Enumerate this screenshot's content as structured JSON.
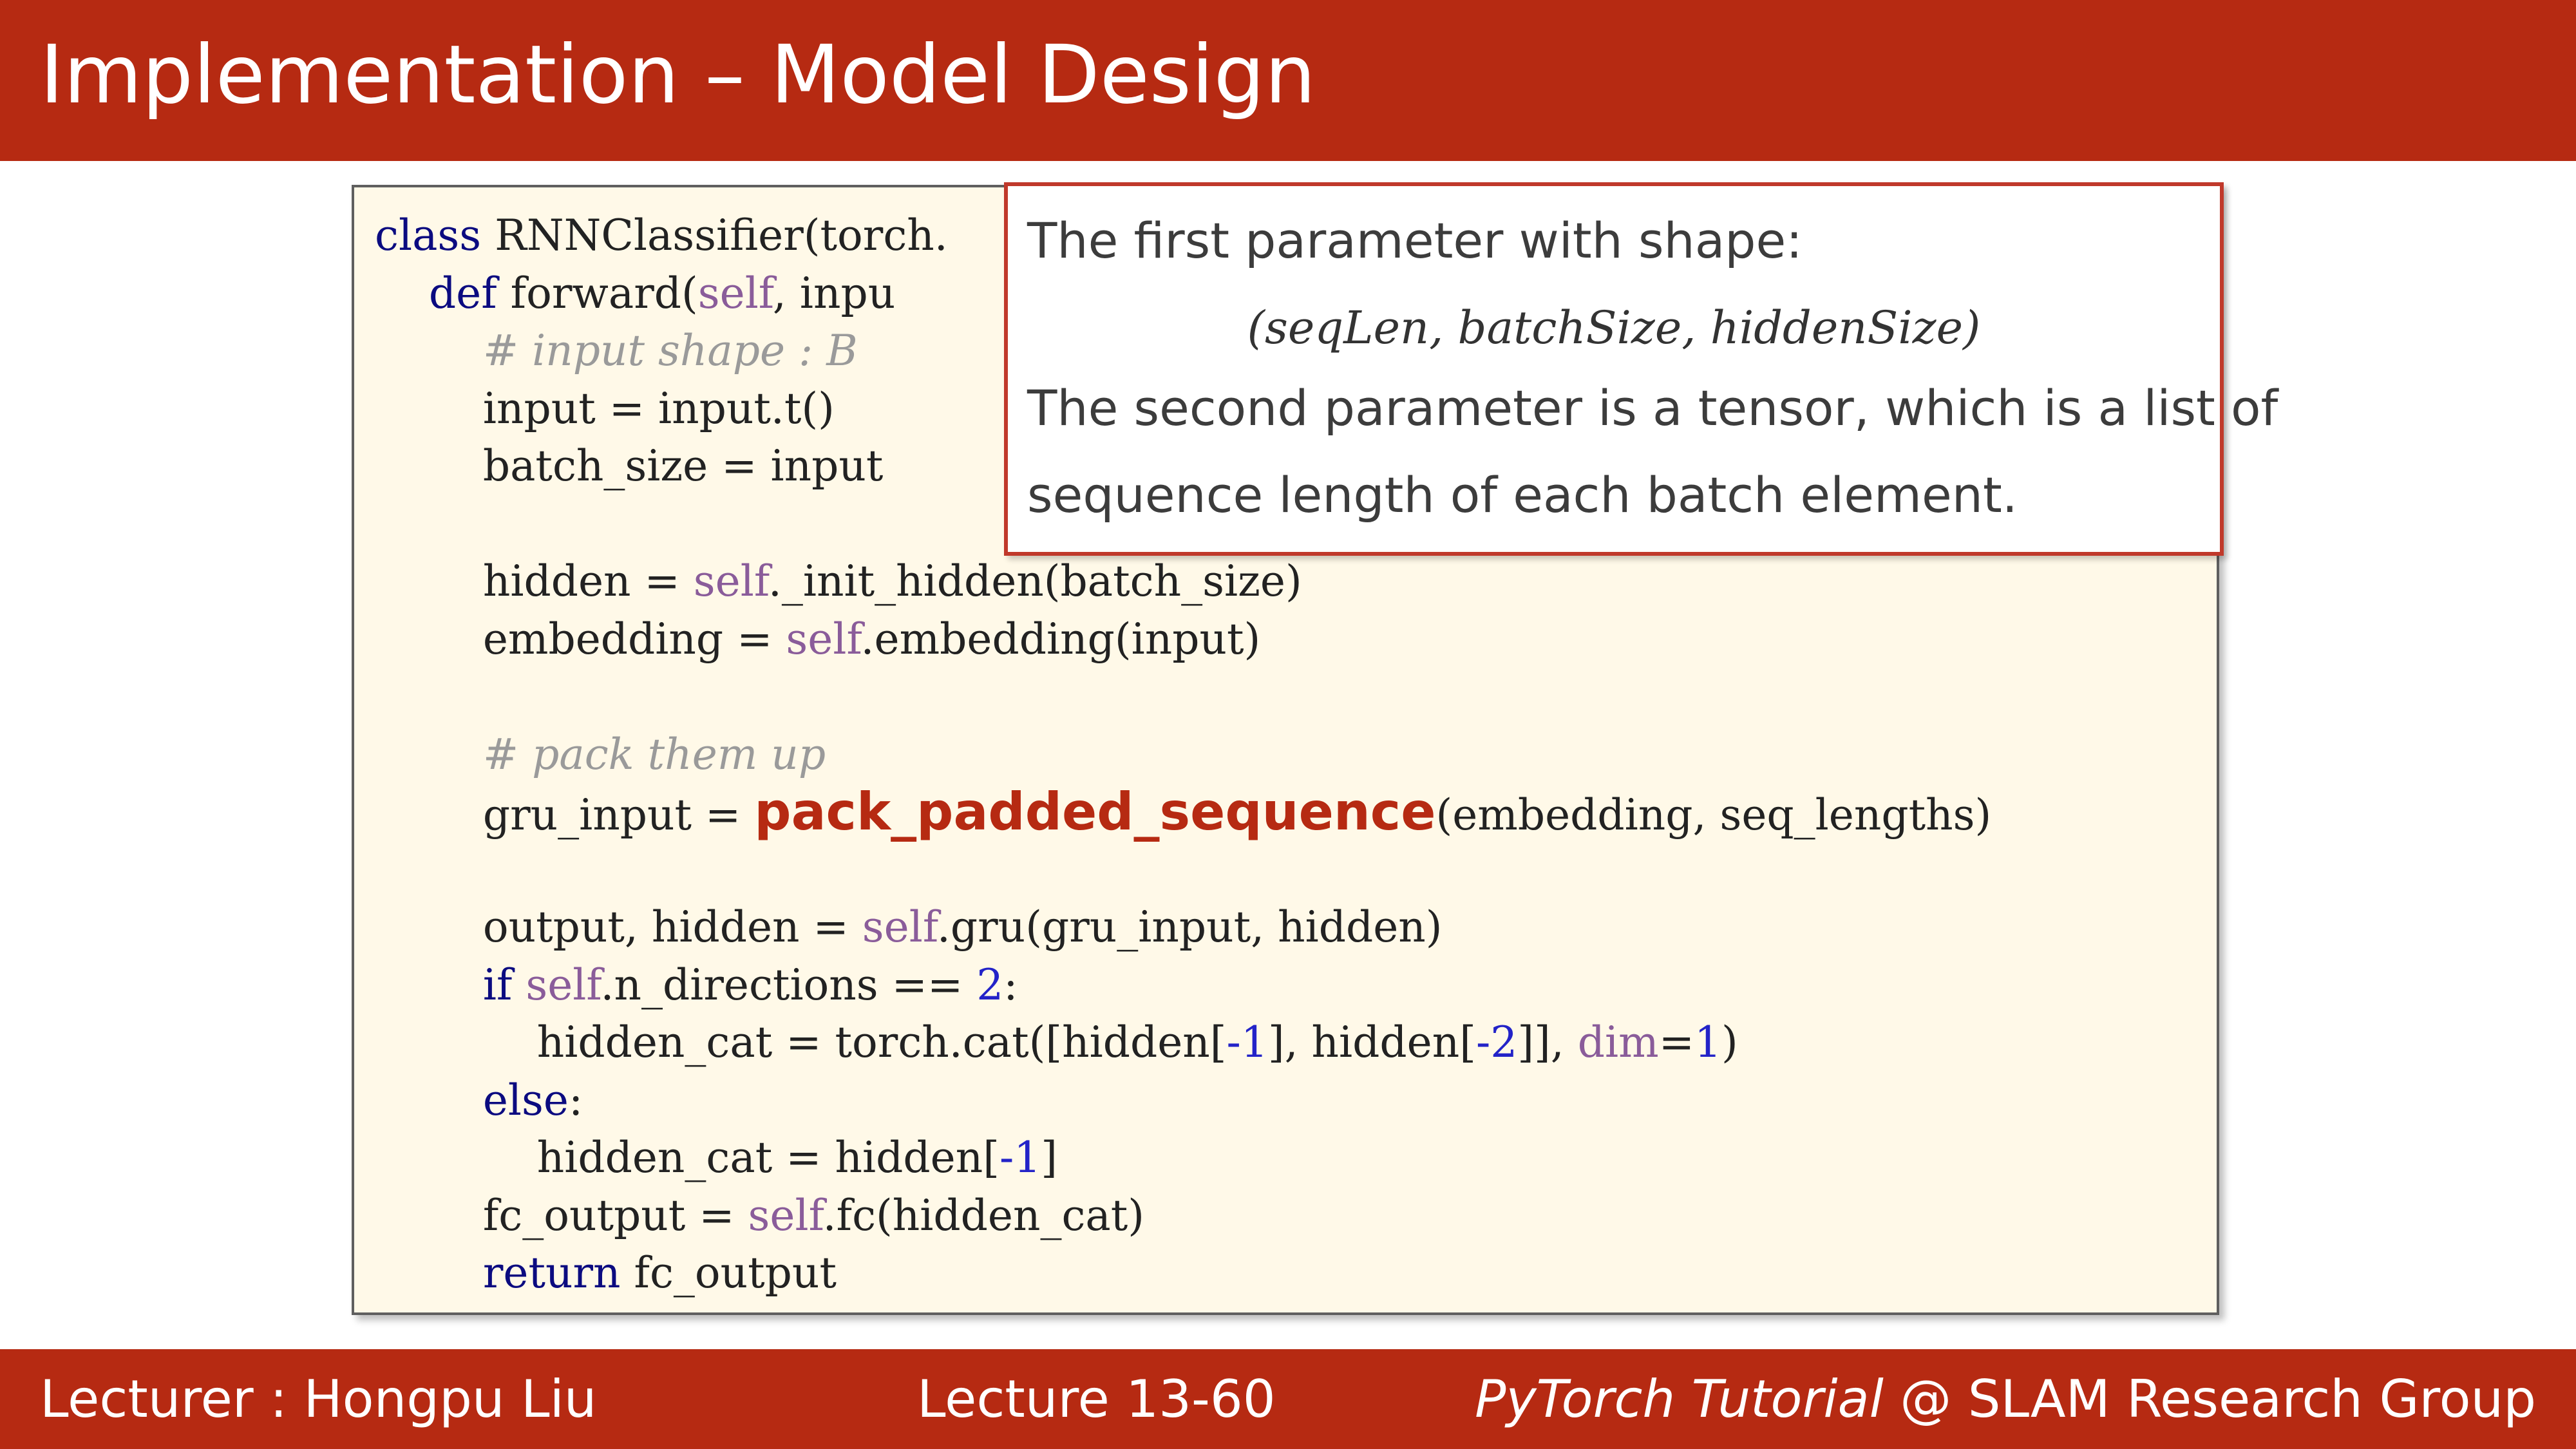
{
  "slide": {
    "title": "Implementation – Model Design"
  },
  "colors": {
    "brand": "#b62a12",
    "code_background": "#fff9e8",
    "callout_border": "#c0392b",
    "keyword": "#0b0b80",
    "self": "#8a5c9a",
    "comment": "#9a9a9a",
    "number": "#2323c8"
  },
  "code": {
    "lines": [
      [
        {
          "t": "class",
          "c": "kw"
        },
        {
          "t": " RNNClassifier(torch."
        }
      ],
      [
        {
          "t": "    "
        },
        {
          "t": "def",
          "c": "kw"
        },
        {
          "t": " forward("
        },
        {
          "t": "self",
          "c": "slf"
        },
        {
          "t": ", inpu"
        }
      ],
      [
        {
          "t": "        "
        },
        {
          "t": "# input shape : B",
          "c": "cm"
        }
      ],
      [
        {
          "t": "        input = input.t()"
        }
      ],
      [
        {
          "t": "        batch_size = input"
        }
      ],
      [
        {
          "t": ""
        }
      ],
      [
        {
          "t": "        hidden = "
        },
        {
          "t": "self",
          "c": "slf"
        },
        {
          "t": "._init_hidden(batch_size)"
        }
      ],
      [
        {
          "t": "        embedding = "
        },
        {
          "t": "self",
          "c": "slf"
        },
        {
          "t": ".embedding(input)"
        }
      ],
      [
        {
          "t": ""
        }
      ],
      [
        {
          "t": "        "
        },
        {
          "t": "# pack them up",
          "c": "cm"
        }
      ],
      [
        {
          "t": "        gru_input = "
        },
        {
          "t": "pack_padded_sequence",
          "c": "hl"
        },
        {
          "t": "(embedding, seq_lengths)"
        }
      ],
      [
        {
          "t": ""
        }
      ],
      [
        {
          "t": "        output, hidden = "
        },
        {
          "t": "self",
          "c": "slf"
        },
        {
          "t": ".gru(gru_input, hidden)"
        }
      ],
      [
        {
          "t": "        "
        },
        {
          "t": "if",
          "c": "kw"
        },
        {
          "t": " "
        },
        {
          "t": "self",
          "c": "slf"
        },
        {
          "t": ".n_directions == "
        },
        {
          "t": "2",
          "c": "num"
        },
        {
          "t": ":"
        }
      ],
      [
        {
          "t": "            hidden_cat = torch.cat([hidden["
        },
        {
          "t": "-1",
          "c": "num"
        },
        {
          "t": "], hidden["
        },
        {
          "t": "-2",
          "c": "num"
        },
        {
          "t": "]], "
        },
        {
          "t": "dim",
          "c": "slf"
        },
        {
          "t": "="
        },
        {
          "t": "1",
          "c": "num"
        },
        {
          "t": ")"
        }
      ],
      [
        {
          "t": "        "
        },
        {
          "t": "else",
          "c": "kw"
        },
        {
          "t": ":"
        }
      ],
      [
        {
          "t": "            hidden_cat = hidden["
        },
        {
          "t": "-1",
          "c": "num"
        },
        {
          "t": "]"
        }
      ],
      [
        {
          "t": "        fc_output = "
        },
        {
          "t": "self",
          "c": "slf"
        },
        {
          "t": ".fc(hidden_cat)"
        }
      ],
      [
        {
          "t": "        "
        },
        {
          "t": "return",
          "c": "kw"
        },
        {
          "t": " fc_output"
        }
      ]
    ]
  },
  "callout": {
    "line1": "The first parameter with shape:",
    "formula": "(seqLen, batchSize, hiddenSize)",
    "line3": "The second parameter is a tensor, which is a list of",
    "line4": "sequence length of each batch element."
  },
  "footer": {
    "lecturer": "Lecturer : Hongpu Liu",
    "lecture": "Lecture 13-60",
    "course_italic": "PyTorch Tutorial",
    "group": " @ SLAM Research Group"
  }
}
